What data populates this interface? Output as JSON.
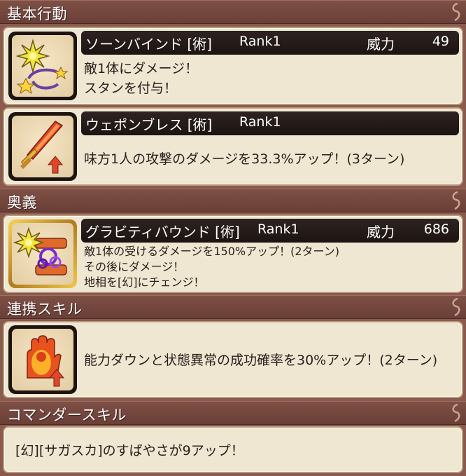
{
  "sections": {
    "basic": "基本行動",
    "ougi": "奥義",
    "renkei": "連携スキル",
    "commander": "コマンダースキル"
  },
  "skills": {
    "s1": {
      "name": "ソーンバインド [術]",
      "rank": "Rank1",
      "power_label": "威力",
      "power_value": "49",
      "lines": [
        "敵1体にダメージ！",
        "スタンを付与！"
      ],
      "icon": "star-stun-icon"
    },
    "s2": {
      "name": "ウェポンブレス [術]",
      "rank": "Rank1",
      "lines": [
        "味方1人の攻撃のダメージを33.3%アップ！(3ターン)"
      ],
      "icon": "flaming-sword-buff-icon"
    },
    "s3": {
      "name": "グラビティバウンド [術]",
      "rank": "Rank1",
      "power_label": "威力",
      "power_value": "686",
      "lines": [
        "敵1体の受けるダメージを150%アップ！(2ターン)",
        "その後にダメージ！",
        "地相を[幻]にチェンジ！"
      ],
      "icon": "gravity-bound-icon"
    },
    "renkei": {
      "lines": [
        "能力ダウンと状態異常の成功確率を30%アップ！(2ターン)"
      ],
      "icon": "flaming-hand-icon"
    },
    "commander": {
      "text": "[幻][サガスカ]のすばやさが9アップ！"
    }
  },
  "colors": {
    "header_bg": "#6a3f37",
    "card_bg": "#f0e7d3",
    "title_bar_bg": "#1c1412",
    "text_dark": "#2a201c"
  }
}
